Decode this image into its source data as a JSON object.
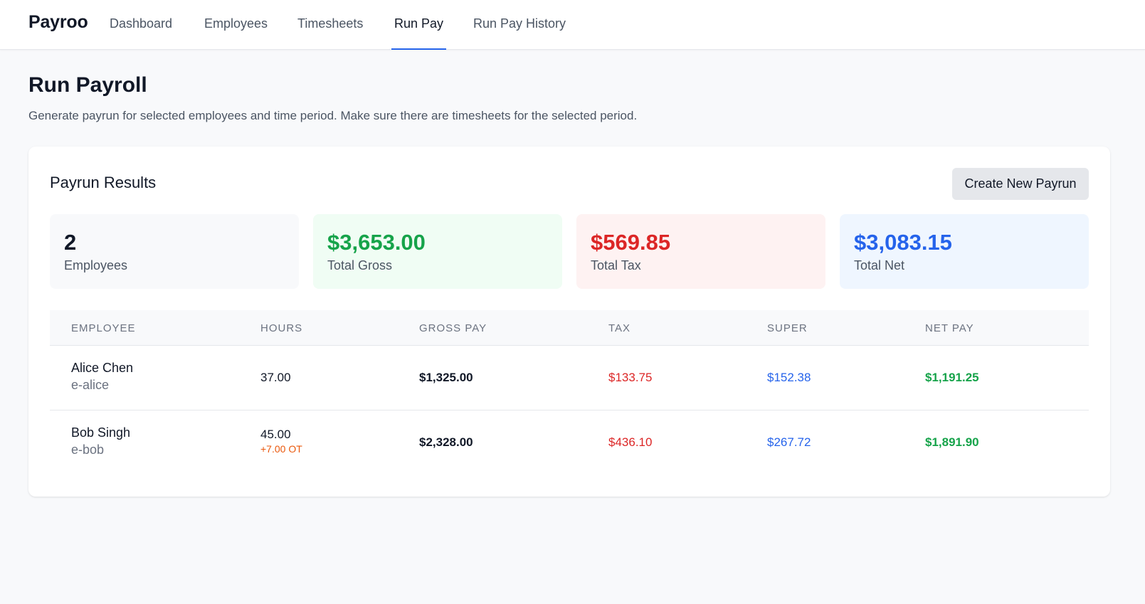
{
  "app": {
    "brand": "Payroo"
  },
  "nav": {
    "items": [
      {
        "label": "Dashboard"
      },
      {
        "label": "Employees"
      },
      {
        "label": "Timesheets"
      },
      {
        "label": "Run Pay"
      },
      {
        "label": "Run Pay History"
      }
    ],
    "active": "Run Pay"
  },
  "page": {
    "title": "Run Payroll",
    "subtitle": "Generate payrun for selected employees and time period. Make sure there are timesheets for the selected period."
  },
  "results": {
    "title": "Payrun Results",
    "create_button": "Create New Payrun",
    "stats": {
      "employees": {
        "value": "2",
        "label": "Employees"
      },
      "gross": {
        "value": "$3,653.00",
        "label": "Total Gross"
      },
      "tax": {
        "value": "$569.85",
        "label": "Total Tax"
      },
      "net": {
        "value": "$3,083.15",
        "label": "Total Net"
      }
    },
    "table": {
      "headers": [
        "EMPLOYEE",
        "HOURS",
        "GROSS PAY",
        "TAX",
        "SUPER",
        "NET PAY"
      ],
      "rows": [
        {
          "name": "Alice Chen",
          "id": "e-alice",
          "hours": "37.00",
          "overtime": "",
          "gross": "$1,325.00",
          "tax": "$133.75",
          "super": "$152.38",
          "net": "$1,191.25"
        },
        {
          "name": "Bob Singh",
          "id": "e-bob",
          "hours": "45.00",
          "overtime": "+7.00 OT",
          "gross": "$2,328.00",
          "tax": "$436.10",
          "super": "$267.72",
          "net": "$1,891.90"
        }
      ]
    }
  },
  "colors": {
    "accent": "#2563eb",
    "gross_green": "#16a34a",
    "tax_red": "#dc2626",
    "overtime_orange": "#ea580c"
  }
}
